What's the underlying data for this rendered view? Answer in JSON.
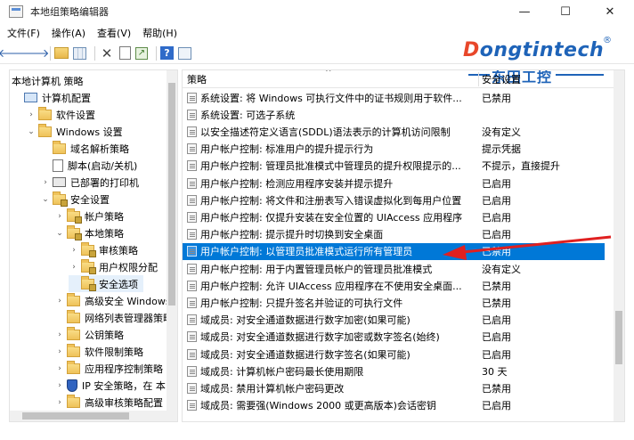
{
  "window": {
    "title": "本地组策略编辑器",
    "minimize": "—",
    "maximize": "☐",
    "close": "✕"
  },
  "menu": [
    "文件(F)",
    "操作(A)",
    "查看(V)",
    "帮助(H)"
  ],
  "toolbar": {
    "back": "🡐",
    "forward": "🡒",
    "help": "?"
  },
  "watermark": {
    "brand_d": "D",
    "brand_rest": "ongtintech",
    "reg": "®",
    "chinese": "东田工控"
  },
  "tree": [
    {
      "label": "本地计算机 策略",
      "indent": 0,
      "chevron": "",
      "icon": "none"
    },
    {
      "label": "计算机配置",
      "indent": 0,
      "chevron": "",
      "icon": "computer"
    },
    {
      "label": "软件设置",
      "indent": 1,
      "chevron": ">",
      "icon": "folder"
    },
    {
      "label": "Windows 设置",
      "indent": 1,
      "chevron": "v",
      "icon": "folder"
    },
    {
      "label": "域名解析策略",
      "indent": 2,
      "chevron": "",
      "icon": "folder"
    },
    {
      "label": "脚本(启动/关机)",
      "indent": 2,
      "chevron": "",
      "icon": "script"
    },
    {
      "label": "已部署的打印机",
      "indent": 2,
      "chevron": ">",
      "icon": "printer"
    },
    {
      "label": "安全设置",
      "indent": 2,
      "chevron": "v",
      "icon": "lockfolder"
    },
    {
      "label": "帐户策略",
      "indent": 3,
      "chevron": ">",
      "icon": "lockfolder"
    },
    {
      "label": "本地策略",
      "indent": 3,
      "chevron": "v",
      "icon": "lockfolder"
    },
    {
      "label": "审核策略",
      "indent": 4,
      "chevron": ">",
      "icon": "lockfolder"
    },
    {
      "label": "用户权限分配",
      "indent": 4,
      "chevron": ">",
      "icon": "lockfolder"
    },
    {
      "label": "安全选项",
      "indent": 4,
      "chevron": "",
      "icon": "lockfolder",
      "selected": true
    },
    {
      "label": "高级安全 Windows",
      "indent": 3,
      "chevron": ">",
      "icon": "folder"
    },
    {
      "label": "网络列表管理器策略",
      "indent": 3,
      "chevron": "",
      "icon": "folder"
    },
    {
      "label": "公钥策略",
      "indent": 3,
      "chevron": ">",
      "icon": "folder"
    },
    {
      "label": "软件限制策略",
      "indent": 3,
      "chevron": ">",
      "icon": "folder"
    },
    {
      "label": "应用程序控制策略",
      "indent": 3,
      "chevron": ">",
      "icon": "folder"
    },
    {
      "label": "IP 安全策略，在 本",
      "indent": 3,
      "chevron": ">",
      "icon": "shield"
    },
    {
      "label": "高级审核策略配置",
      "indent": 3,
      "chevron": ">",
      "icon": "folder"
    }
  ],
  "list": {
    "header_policy": "策略",
    "header_sort_indicator": "^",
    "header_setting": "安全设置",
    "rows": [
      {
        "name": "系统设置: 将 Windows 可执行文件中的证书规则用于软件...",
        "setting": "已禁用"
      },
      {
        "name": "系统设置: 可选子系统",
        "setting": ""
      },
      {
        "name": "以安全描述符定义语言(SDDL)语法表示的计算机访问限制",
        "setting": "没有定义"
      },
      {
        "name": "用户帐户控制: 标准用户的提升提示行为",
        "setting": "提示凭据"
      },
      {
        "name": "用户帐户控制: 管理员批准模式中管理员的提升权限提示的...",
        "setting": "不提示，直接提升"
      },
      {
        "name": "用户帐户控制: 检测应用程序安装并提示提升",
        "setting": "已启用"
      },
      {
        "name": "用户帐户控制: 将文件和注册表写入错误虚拟化到每用户位置",
        "setting": "已启用"
      },
      {
        "name": "用户帐户控制: 仅提升安装在安全位置的 UIAccess 应用程序",
        "setting": "已启用"
      },
      {
        "name": "用户帐户控制: 提示提升时切换到安全桌面",
        "setting": "已启用"
      },
      {
        "name": "用户帐户控制: 以管理员批准模式运行所有管理员",
        "setting": "已禁用",
        "selected": true
      },
      {
        "name": "用户帐户控制: 用于内置管理员帐户的管理员批准模式",
        "setting": "没有定义"
      },
      {
        "name": "用户帐户控制: 允许 UIAccess 应用程序在不使用安全桌面...",
        "setting": "已禁用"
      },
      {
        "name": "用户帐户控制: 只提升签名并验证的可执行文件",
        "setting": "已禁用"
      },
      {
        "name": "域成员: 对安全通道数据进行数字加密(如果可能)",
        "setting": "已启用"
      },
      {
        "name": "域成员: 对安全通道数据进行数字加密或数字签名(始终)",
        "setting": "已启用"
      },
      {
        "name": "域成员: 对安全通道数据进行数字签名(如果可能)",
        "setting": "已启用"
      },
      {
        "name": "域成员: 计算机帐户密码最长使用期限",
        "setting": "30 天"
      },
      {
        "name": "域成员: 禁用计算机帐户密码更改",
        "setting": "已禁用"
      },
      {
        "name": "域成员: 需要强(Windows 2000 或更高版本)会话密钥",
        "setting": "已启用"
      }
    ]
  },
  "colors": {
    "selection": "#0078d7",
    "annotation_arrow": "#e02020",
    "brand_blue": "#1e63b8",
    "brand_red": "#e8472a"
  }
}
